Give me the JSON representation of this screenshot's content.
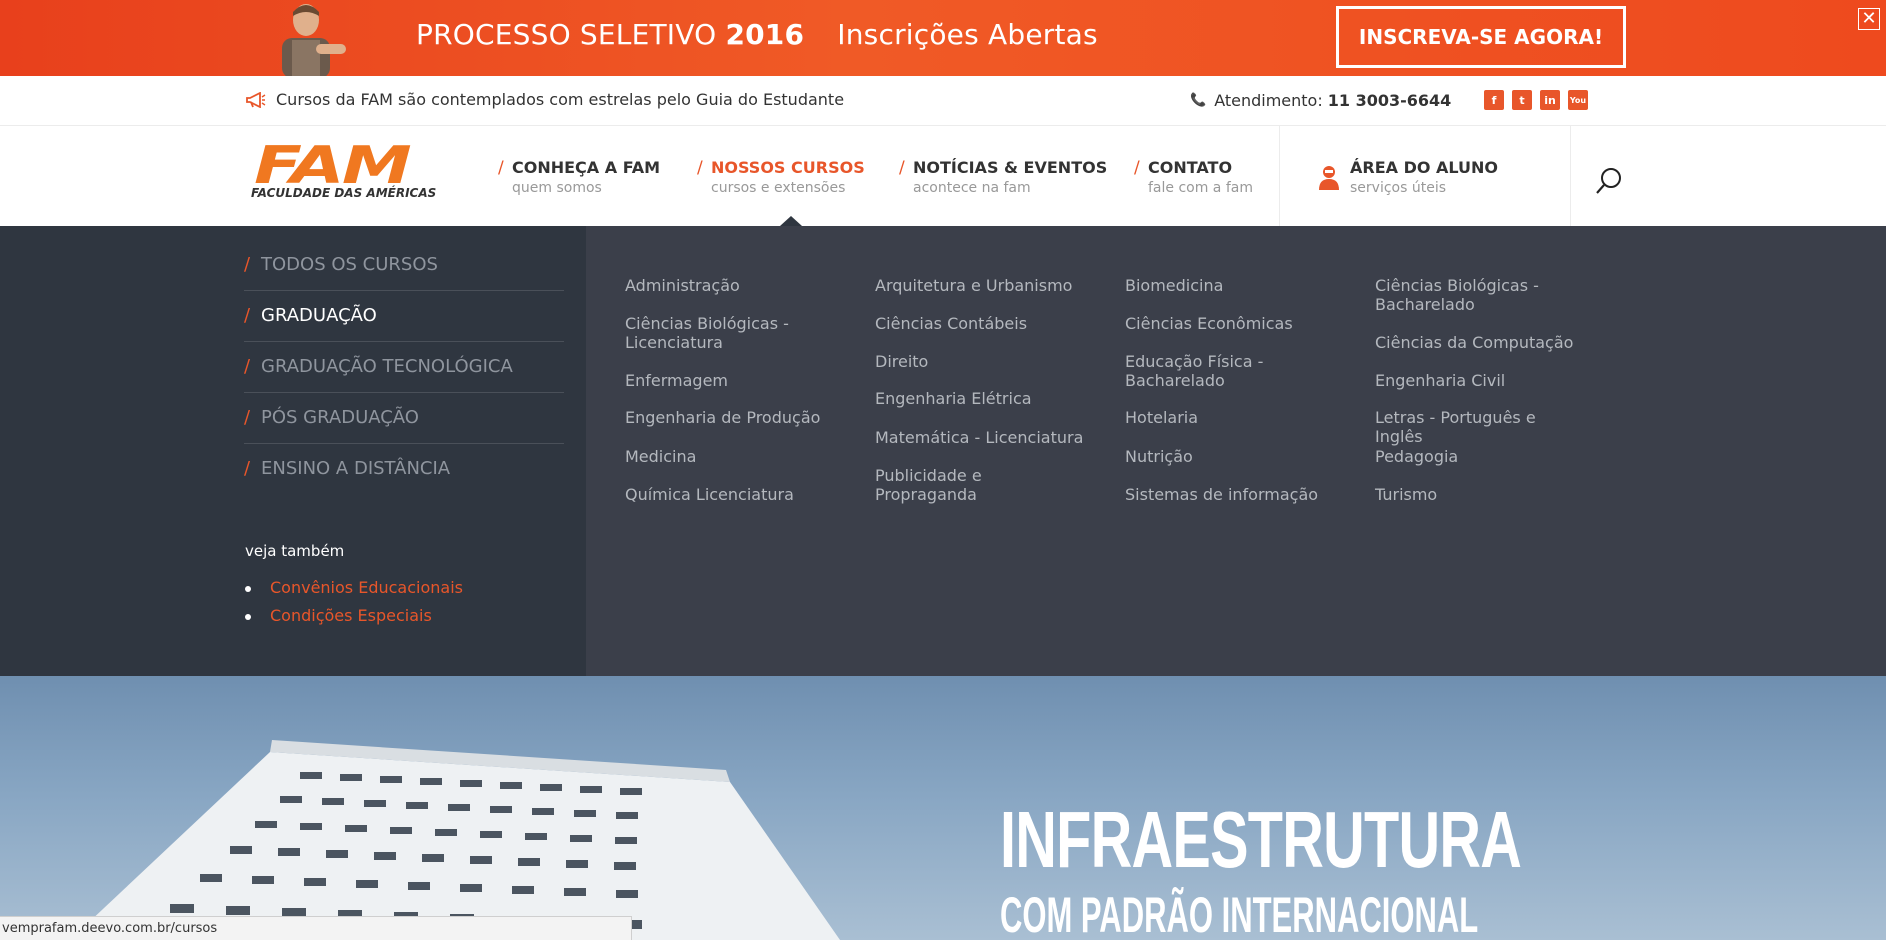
{
  "promo": {
    "title_prefix": "PROCESSO SELETIVO",
    "year": "2016",
    "subtitle": "Inscrições Abertas",
    "cta": "INSCREVA-SE AGORA!",
    "close": "✕",
    "bg_color": "#ee4a1e"
  },
  "infobar": {
    "news": "Cursos da FAM são contemplados com estrelas pelo Guia do Estudante",
    "phone_label": "Atendimento:",
    "phone_number": "11 3003-6644",
    "social": [
      {
        "icon": "facebook-icon",
        "glyph": "f"
      },
      {
        "icon": "twitter-icon",
        "glyph": "t"
      },
      {
        "icon": "linkedin-icon",
        "glyph": "in"
      },
      {
        "icon": "youtube-icon",
        "glyph": "You"
      }
    ]
  },
  "logo": {
    "brand": "FAM",
    "tagline": "FACULDADE DAS AMÉRICAS"
  },
  "nav": {
    "items": [
      {
        "title": "CONHEÇA A FAM",
        "subtitle": "quem somos"
      },
      {
        "title": "NOSSOS CURSOS",
        "subtitle": "cursos e extensões"
      },
      {
        "title": "NOTÍCIAS & EVENTOS",
        "subtitle": "acontece na fam"
      },
      {
        "title": "CONTATO",
        "subtitle": "fale com a fam"
      }
    ],
    "student_area": {
      "title": "ÁREA DO ALUNO",
      "subtitle": "serviços úteis"
    },
    "accent": "#e8562a"
  },
  "mega": {
    "categories": [
      {
        "label": "TODOS OS CURSOS"
      },
      {
        "label": "GRADUAÇÃO"
      },
      {
        "label": "GRADUAÇÃO TECNOLÓGICA"
      },
      {
        "label": "PÓS GRADUAÇÃO"
      },
      {
        "label": "ENSINO A DISTÂNCIA"
      }
    ],
    "see_also_title": "veja também",
    "see_also": [
      "Convênios Educacionais",
      "Condições Especiais"
    ],
    "courses": [
      "Administração",
      "Arquitetura e Urbanismo",
      "Biomedicina",
      "Ciências Biológicas - Bacharelado",
      "Ciências Biológicas - Licenciatura",
      "Ciências Contábeis",
      "Ciências Econômicas",
      "Ciências da Computação",
      "Direito",
      "Educação Física - Bacharelado",
      "Enfermagem",
      "Engenharia Civil",
      "Engenharia Elétrica",
      "Engenharia de Produção",
      "Hotelaria",
      "Letras - Português e Inglês",
      "Matemática - Licenciatura",
      "Medicina",
      "Nutrição",
      "Pedagogia",
      "Publicidade e Propraganda",
      "Química Licenciatura",
      "Sistemas de informação",
      "Turismo"
    ]
  },
  "hero": {
    "title": "INFRAESTRUTURA",
    "subtitle": "COM PADRÃO INTERNACIONAL"
  },
  "statusbar": {
    "url": "vemprafam.deevo.com.br/cursos"
  }
}
